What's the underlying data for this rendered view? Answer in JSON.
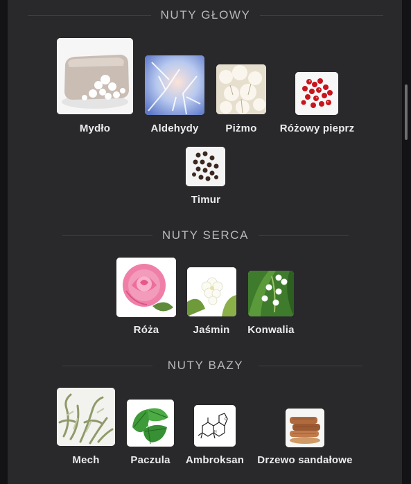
{
  "sections": [
    {
      "title": "NUTY GŁOWY",
      "notes": [
        {
          "name": "Mydło",
          "icon": "soap-icon"
        },
        {
          "name": "Aldehydy",
          "icon": "frost-icon"
        },
        {
          "name": "Piżmo",
          "icon": "musk-fluff-icon"
        },
        {
          "name": "Różowy pieprz",
          "icon": "pink-pepper-icon"
        },
        {
          "name": "Timur",
          "icon": "timur-pepper-icon"
        }
      ]
    },
    {
      "title": "NUTY SERCA",
      "notes": [
        {
          "name": "Róża",
          "icon": "rose-icon"
        },
        {
          "name": "Jaśmin",
          "icon": "jasmine-icon"
        },
        {
          "name": "Konwalia",
          "icon": "lily-of-the-valley-icon"
        }
      ]
    },
    {
      "title": "NUTY BAZY",
      "notes": [
        {
          "name": "Mech",
          "icon": "moss-icon"
        },
        {
          "name": "Paczula",
          "icon": "patchouli-leaf-icon"
        },
        {
          "name": "Ambroksan",
          "icon": "ambroxan-molecule-icon"
        },
        {
          "name": "Drzewo sandałowe",
          "icon": "sandalwood-icon"
        }
      ]
    }
  ]
}
